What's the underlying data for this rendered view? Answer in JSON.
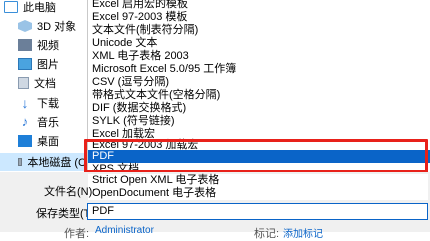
{
  "nav": {
    "items": [
      {
        "label": "此电脑",
        "icon": "computer-icon"
      },
      {
        "label": "3D 对象",
        "icon": "3d-objects-icon"
      },
      {
        "label": "视频",
        "icon": "video-icon"
      },
      {
        "label": "图片",
        "icon": "pictures-icon"
      },
      {
        "label": "文档",
        "icon": "documents-icon"
      },
      {
        "label": "下载",
        "icon": "downloads-icon"
      },
      {
        "label": "音乐",
        "icon": "music-icon"
      },
      {
        "label": "桌面",
        "icon": "desktop-icon"
      },
      {
        "label": "本地磁盘 (C",
        "icon": "drive-icon"
      }
    ]
  },
  "dropdown": {
    "options": [
      "Excel 启用宏的模板",
      "Excel 97-2003 模板",
      "文本文件(制表符分隔)",
      "Unicode 文本",
      "XML 电子表格 2003",
      "Microsoft Excel 5.0/95 工作簿",
      "CSV (逗号分隔)",
      "带格式文本文件(空格分隔)",
      "DIF (数据交换格式)",
      "SYLK (符号链接)",
      "Excel 加载宏",
      "Excel 97-2003 加载宏",
      "PDF",
      "XPS 文档",
      "Strict Open XML 电子表格",
      "OpenDocument 电子表格"
    ],
    "selected_index": 12
  },
  "form": {
    "filename_label": "文件名(N):",
    "savetype_label": "保存类型(T):",
    "savetype_value": "PDF",
    "author_label": "作者:",
    "author_value": "Administrator",
    "tags_label": "标记:",
    "tags_link": "添加标记"
  },
  "colors": {
    "selection": "#0a64c8",
    "highlight_box": "#e8211a",
    "nav_selected": "#cce8ff"
  }
}
